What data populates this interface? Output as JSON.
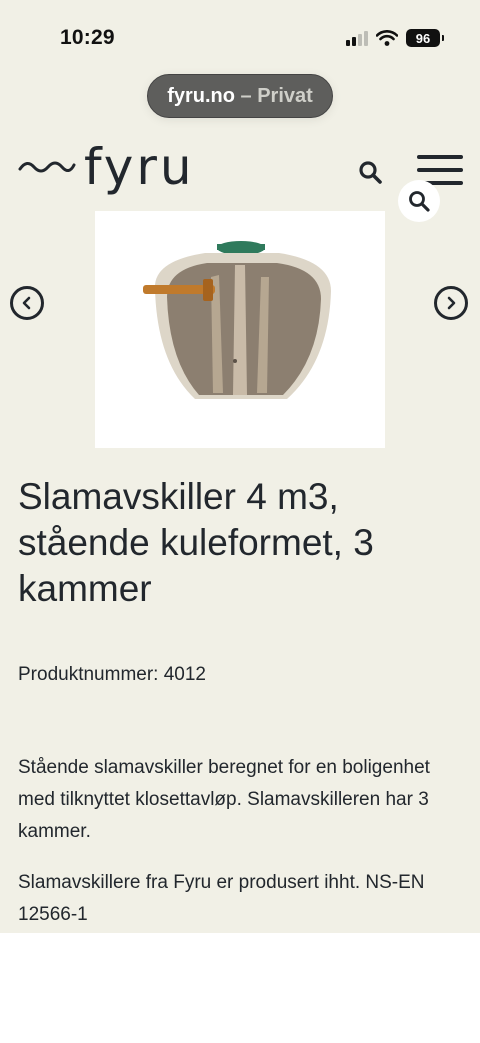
{
  "status_bar": {
    "time": "10:29",
    "battery": "96"
  },
  "browser": {
    "domain": "fyru.no",
    "separator": " – ",
    "mode": "Privat"
  },
  "header": {
    "logo_text": "fyru"
  },
  "product": {
    "title": "Slamavskiller 4 m3, stående kuleformet, 3 kammer",
    "number_label": "Produktnummer: 4012",
    "description": [
      "Stående slamavskiller beregnet for en boligenhet med tilknyttet klosettavløp. Slamavskilleren har 3 kammer.",
      "Slamavskillere fra Fyru er produsert ihht. NS-EN 12566-1"
    ]
  },
  "colors": {
    "page_background": "#f1f0e6",
    "text": "#22272d",
    "tank_lid": "#2f7a5c",
    "pipe": "#c07a2c"
  },
  "icons": [
    "search-icon",
    "hamburger-menu-icon",
    "zoom-icon",
    "chevron-left-icon",
    "chevron-right-icon",
    "wifi-icon",
    "signal-icon",
    "battery-icon"
  ]
}
